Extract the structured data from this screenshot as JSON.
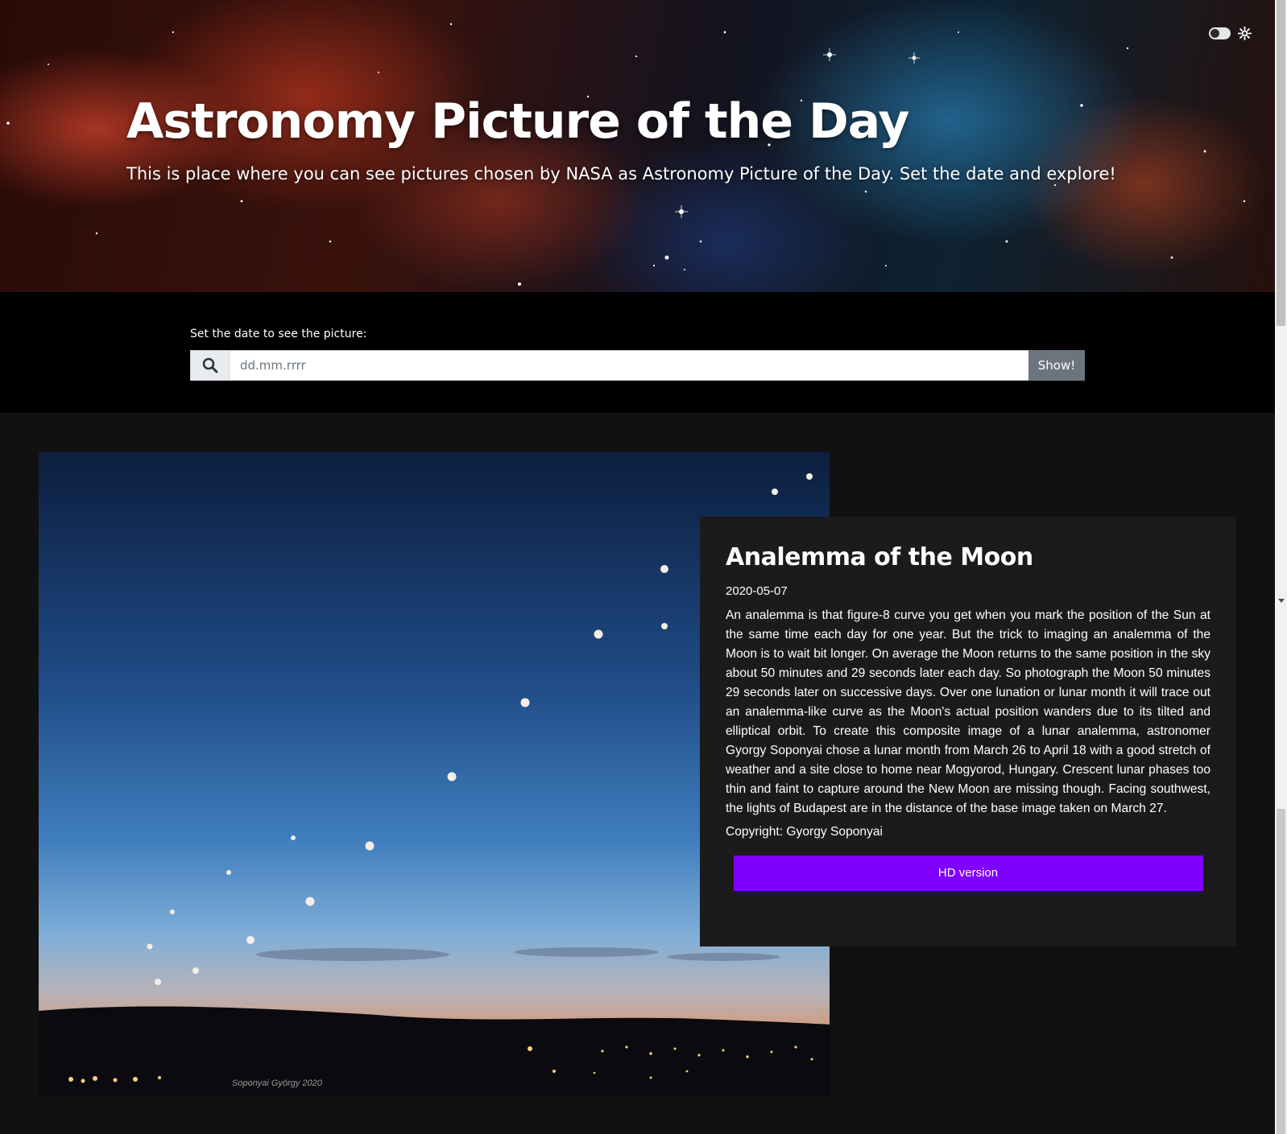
{
  "header": {
    "title": "Astronomy Picture of the Day",
    "subtitle": "This is place where you can see pictures chosen by NASA as Astronomy Picture of the Day. Set the date and explore!",
    "theme_toggle_icon": "toggle-icon",
    "theme_icon": "sun-icon"
  },
  "search": {
    "label": "Set the date to see the picture:",
    "placeholder": "dd.mm.rrrr",
    "value": "",
    "button_label": "Show!",
    "icon": "search-icon"
  },
  "picture": {
    "title": "Analemma of the Moon",
    "date": "2020-05-07",
    "explanation": "An analemma is that figure-8 curve you get when you mark the position of the Sun at the same time each day for one year. But the trick to imaging an analemma of the Moon is to wait bit longer. On average the Moon returns to the same position in the sky about 50 minutes and 29 seconds later each day. So photograph the Moon 50 minutes 29 seconds later on successive days. Over one lunation or lunar month it will trace out an analemma-like curve as the Moon's actual position wanders due to its tilted and elliptical orbit. To create this composite image of a lunar analemma, astronomer Gyorgy Soponyai chose a lunar month from March 26 to April 18 with a good stretch of weather and a site close to home near Mogyorod, Hungary. Crescent lunar phases too thin and faint to capture around the New Moon are missing though. Facing southwest, the lights of Budapest are in the distance of the base image taken on March 27.",
    "copyright": "Copyright: Gyorgy Soponyai",
    "hd_button_label": "HD version",
    "photo_watermark": "Soponyai György   2020"
  },
  "colors": {
    "accent": "#8000ff",
    "show_button": "#6c757d",
    "card_bg": "#1b1b1b",
    "page_bg": "#111111"
  }
}
